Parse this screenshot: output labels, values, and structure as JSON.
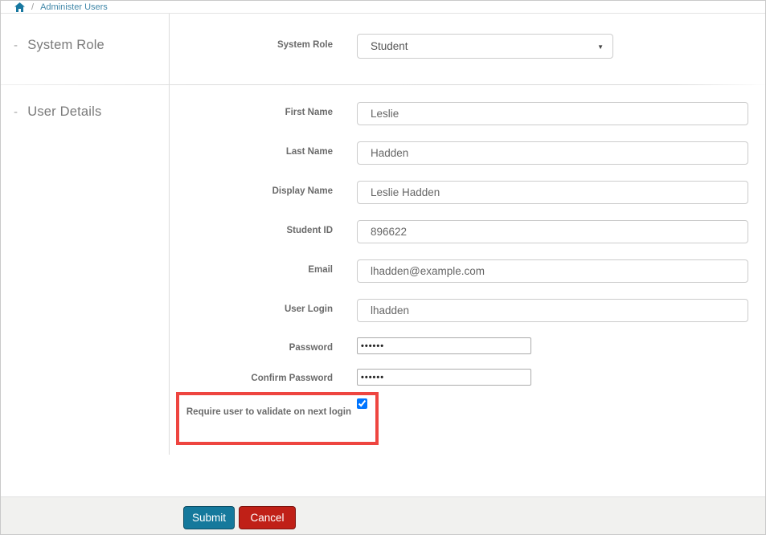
{
  "breadcrumb": {
    "separator": "/",
    "current": "Administer Users"
  },
  "sidebar": {
    "collapse_glyph": "-",
    "sections": [
      {
        "label": "System Role"
      },
      {
        "label": "User Details"
      }
    ]
  },
  "form": {
    "system_role": {
      "label": "System Role",
      "value": "Student",
      "dropdown_arrow": "▼"
    },
    "fields": [
      {
        "label": "First Name",
        "value": "Leslie"
      },
      {
        "label": "Last Name",
        "value": "Hadden"
      },
      {
        "label": "Display Name",
        "value": "Leslie Hadden"
      },
      {
        "label": "Student ID",
        "value": "896622"
      },
      {
        "label": "Email",
        "value": "lhadden@example.com"
      },
      {
        "label": "User Login",
        "value": "lhadden"
      }
    ],
    "password": {
      "label": "Password",
      "masked_value": "••••••"
    },
    "confirm_password": {
      "label": "Confirm Password",
      "masked_value": "••••••"
    },
    "validate_checkbox": {
      "label": "Require user to validate on next login",
      "checked": true
    }
  },
  "footer": {
    "submit_label": "Submit",
    "cancel_label": "Cancel"
  },
  "colors": {
    "accent_teal": "#15799c",
    "cancel_red": "#c02017",
    "highlight_red": "#ee4540",
    "breadcrumb_blue": "#4288a9"
  }
}
